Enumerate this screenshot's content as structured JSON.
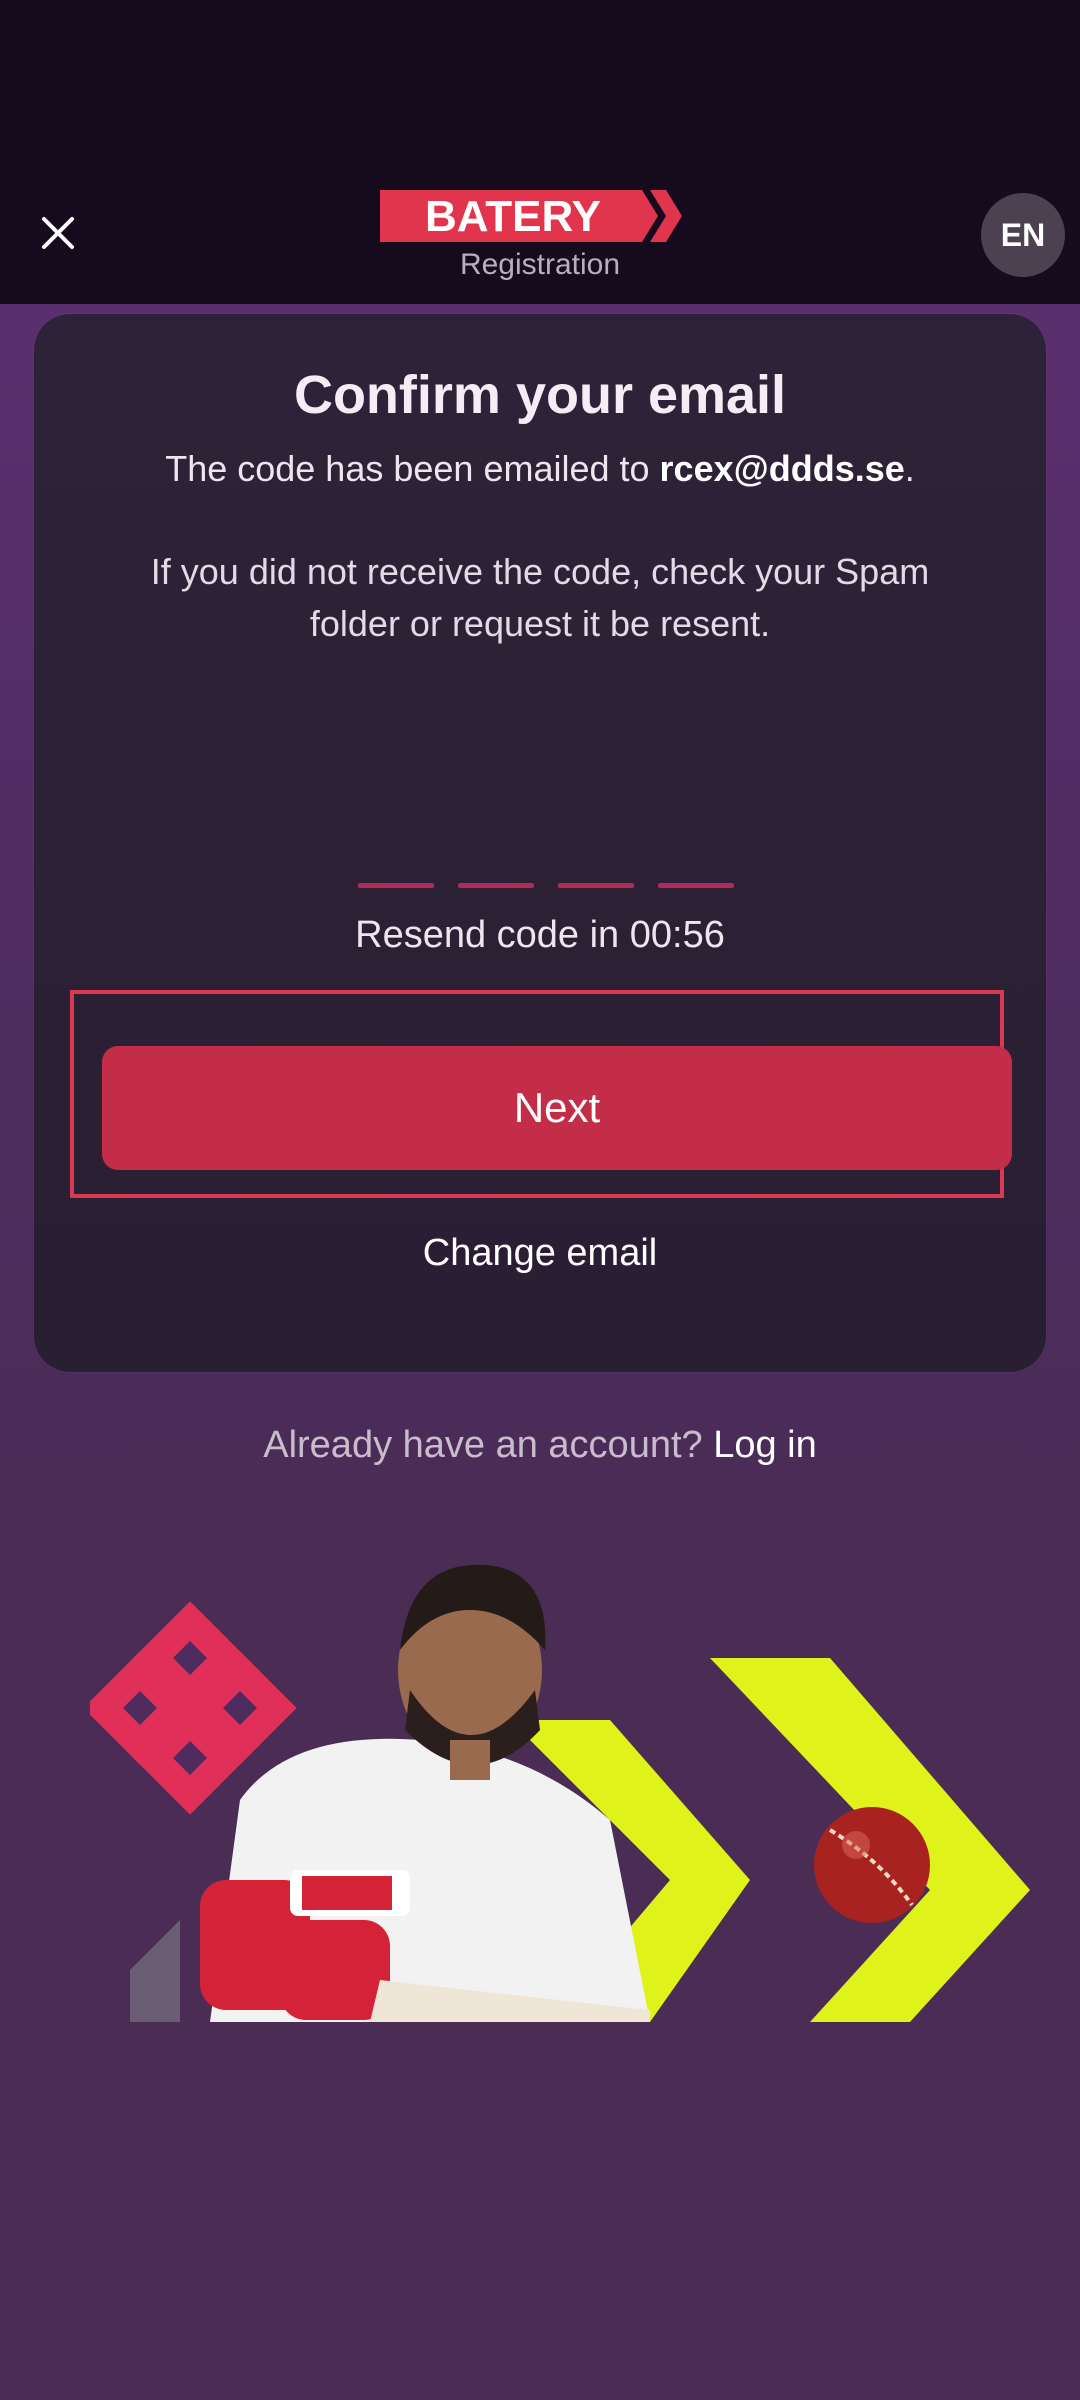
{
  "header": {
    "brand": "BATERY",
    "subtitle": "Registration",
    "language": "EN"
  },
  "card": {
    "title": "Confirm your email",
    "sent_prefix": "The code has been emailed to ",
    "email": "rcex@ddds.se",
    "sent_suffix": ".",
    "spam_hint": "If you did not receive the code, check your Spam folder or request it be resent.",
    "code_slots": 4,
    "resend_text": "Resend code in 00:56",
    "next_label": "Next",
    "change_email_label": "Change email"
  },
  "footer": {
    "already_text": "Already have an account? ",
    "login_label": "Log in"
  },
  "colors": {
    "header_bg": "#160a1d",
    "accent": "#c42d48",
    "lime": "#dff21a",
    "highlight": "#d93a53"
  }
}
